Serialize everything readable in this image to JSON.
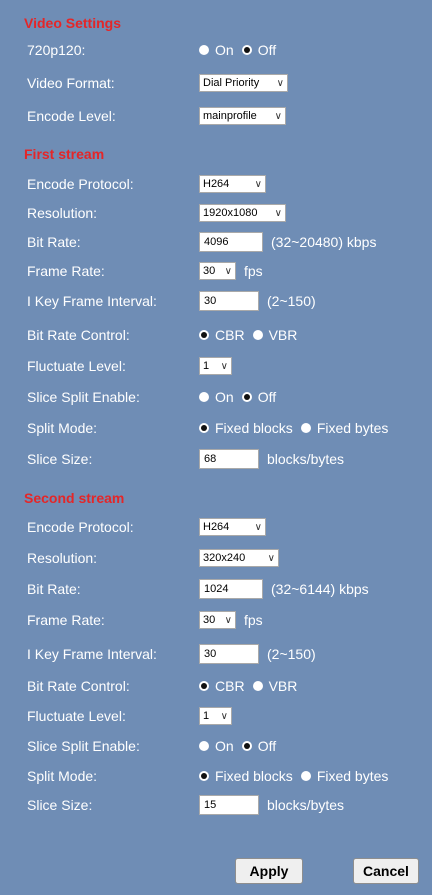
{
  "video_settings": {
    "title": "Video Settings",
    "p120": {
      "label": "720p120:",
      "on": "On",
      "off": "Off",
      "selected": "off"
    },
    "video_format": {
      "label": "Video Format:",
      "value": "Dial Priority"
    },
    "encode_level": {
      "label": "Encode Level:",
      "value": "mainprofile"
    }
  },
  "first_stream": {
    "title": "First stream",
    "encode_protocol": {
      "label": "Encode Protocol:",
      "value": "H264"
    },
    "resolution": {
      "label": "Resolution:",
      "value": "1920x1080"
    },
    "bit_rate": {
      "label": "Bit Rate:",
      "value": "4096",
      "hint": "(32~20480) kbps"
    },
    "frame_rate": {
      "label": "Frame Rate:",
      "value": "30",
      "unit": "fps"
    },
    "ikey": {
      "label": "I Key Frame Interval:",
      "value": "30",
      "hint": "(2~150)"
    },
    "bitrate_control": {
      "label": "Bit Rate Control:",
      "opt1": "CBR",
      "opt2": "VBR",
      "selected": "CBR"
    },
    "fluctuate": {
      "label": "Fluctuate Level:",
      "value": "1"
    },
    "slice_split": {
      "label": "Slice Split Enable:",
      "on": "On",
      "off": "Off",
      "selected": "off"
    },
    "split_mode": {
      "label": "Split Mode:",
      "opt1": "Fixed blocks",
      "opt2": "Fixed bytes",
      "selected": "Fixed blocks"
    },
    "slice_size": {
      "label": "Slice Size:",
      "value": "68",
      "unit": "blocks/bytes"
    }
  },
  "second_stream": {
    "title": "Second stream",
    "encode_protocol": {
      "label": "Encode Protocol:",
      "value": "H264"
    },
    "resolution": {
      "label": "Resolution:",
      "value": "320x240"
    },
    "bit_rate": {
      "label": "Bit Rate:",
      "value": "1024",
      "hint": "(32~6144) kbps"
    },
    "frame_rate": {
      "label": "Frame Rate:",
      "value": "30",
      "unit": "fps"
    },
    "ikey": {
      "label": "I Key Frame Interval:",
      "value": "30",
      "hint": "(2~150)"
    },
    "bitrate_control": {
      "label": "Bit Rate Control:",
      "opt1": "CBR",
      "opt2": "VBR",
      "selected": "CBR"
    },
    "fluctuate": {
      "label": "Fluctuate Level:",
      "value": "1"
    },
    "slice_split": {
      "label": "Slice Split Enable:",
      "on": "On",
      "off": "Off",
      "selected": "off"
    },
    "split_mode": {
      "label": "Split Mode:",
      "opt1": "Fixed blocks",
      "opt2": "Fixed bytes",
      "selected": "Fixed blocks"
    },
    "slice_size": {
      "label": "Slice Size:",
      "value": "15",
      "unit": "blocks/bytes"
    }
  },
  "buttons": {
    "apply": "Apply",
    "cancel": "Cancel"
  },
  "colors": {
    "background": "#6f8db5",
    "section_title": "#e42628"
  },
  "icons": {
    "dropdown": "chevron-down-icon",
    "radio": "radio-icon"
  }
}
